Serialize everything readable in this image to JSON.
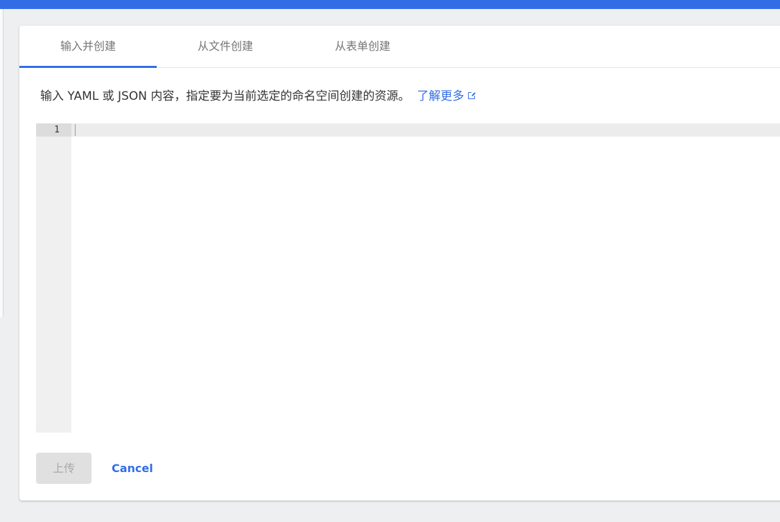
{
  "tabs": [
    {
      "label": "输入并创建",
      "active": true
    },
    {
      "label": "从文件创建",
      "active": false
    },
    {
      "label": "从表单创建",
      "active": false
    }
  ],
  "description": {
    "text": "输入 YAML 或 JSON 内容，指定要为当前选定的命名空间创建的资源。",
    "link_label": "了解更多",
    "link_icon": "open-in-new-icon"
  },
  "editor": {
    "line_numbers": [
      "1"
    ],
    "content": ""
  },
  "actions": {
    "upload_label": "上传",
    "upload_disabled": true,
    "cancel_label": "Cancel"
  },
  "colors": {
    "accent": "#326de6",
    "disabled_button": "#e0e0e0"
  }
}
